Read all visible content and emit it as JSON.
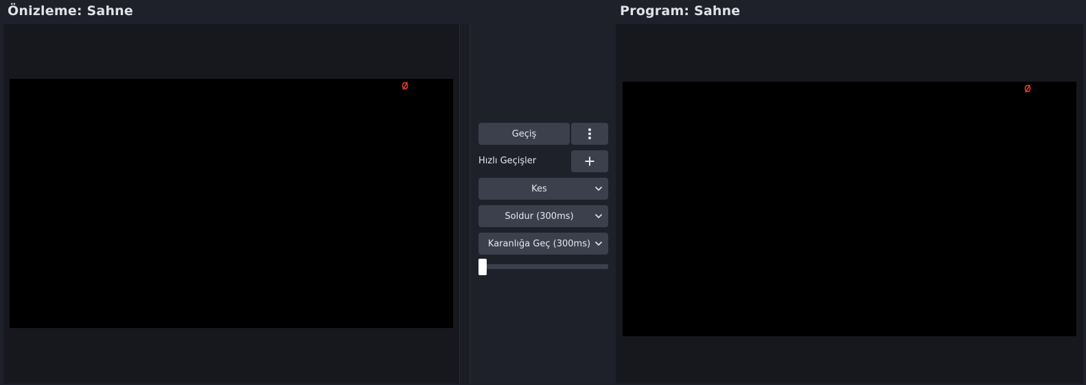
{
  "preview": {
    "title": "Önizleme: Sahne"
  },
  "program": {
    "title": "Program: Sahne"
  },
  "controls": {
    "transition_label": "Geçiş",
    "menu_icon": "more-vertical-icon",
    "quick_transitions_label": "Hızlı Geçişler",
    "add_icon": "plus-icon",
    "quick_items": [
      {
        "label": "Kes"
      },
      {
        "label": "Soldur (300ms)"
      },
      {
        "label": "Karanlığa Geç (300ms)"
      }
    ],
    "tbar_position": 0
  },
  "colors": {
    "background": "#1e212a",
    "pane": "#17181e",
    "button": "#3c404d",
    "text": "#e0e3ea",
    "mic_red": "#e0402f"
  }
}
